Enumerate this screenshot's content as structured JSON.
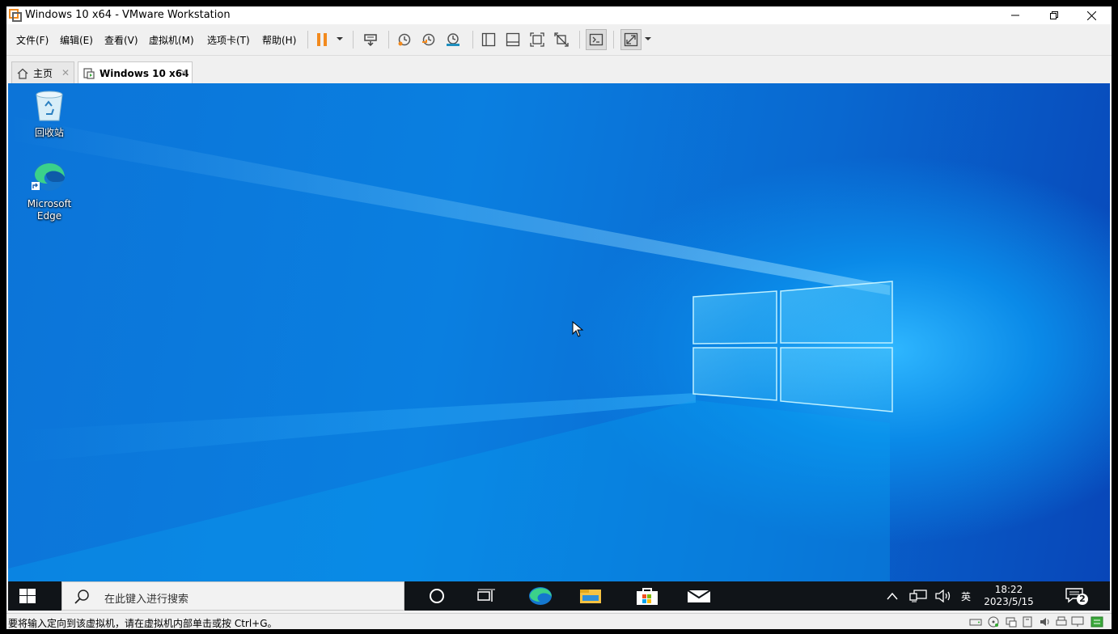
{
  "window": {
    "title": "Windows 10 x64 - VMware Workstation",
    "minimize_glyph": "—",
    "restore_glyph": "❐",
    "close_glyph": "✕"
  },
  "menu": {
    "items": [
      "文件(F)",
      "编辑(E)",
      "查看(V)",
      "虚拟机(M)",
      "选项卡(T)",
      "帮助(H)"
    ]
  },
  "tabs": [
    {
      "label": "主页",
      "close": "✕"
    },
    {
      "label": "Windows 10 x64",
      "close": "✕"
    }
  ],
  "desktop": {
    "icons": [
      {
        "label": "回收站"
      },
      {
        "label": "Microsoft Edge"
      }
    ]
  },
  "taskbar": {
    "search_placeholder": "在此键入进行搜索",
    "tray_ime": "英",
    "clock_time": "18:22",
    "clock_date": "2023/5/15",
    "notification_count": "2"
  },
  "statusbar": {
    "text": "要将输入定向到该虚拟机，请在虚拟机内部单击或按 Ctrl+G。"
  },
  "colors": {
    "accent_orange": "#f28a1e",
    "desktop_blue": "#0a7fe0",
    "taskbar": "#101418"
  }
}
